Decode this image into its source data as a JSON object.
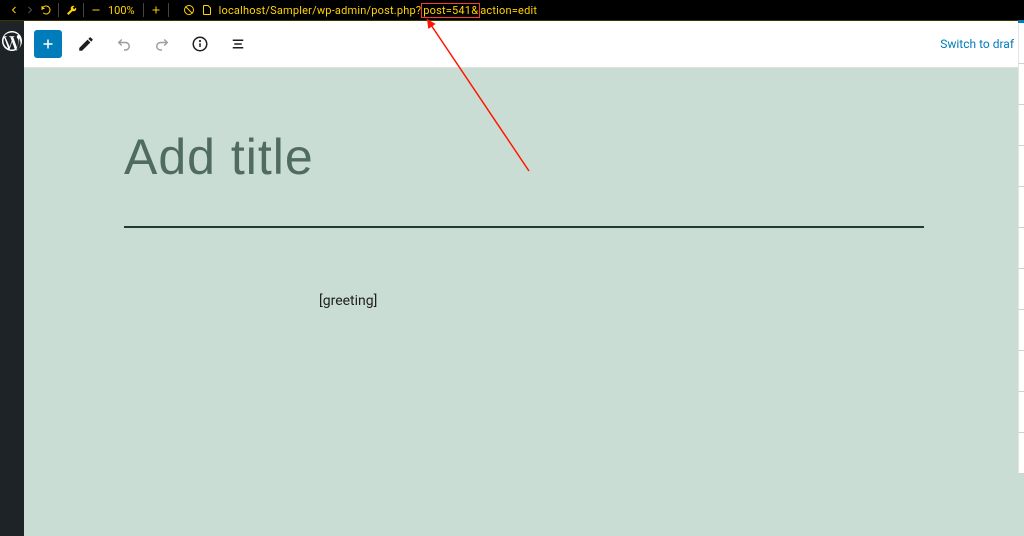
{
  "browser": {
    "zoom": "100%",
    "url_pre": "localhost/Sampler/wp-admin/post.php?",
    "url_highlight": "post=541&",
    "url_post": "action=edit"
  },
  "toolbar": {
    "switch_draft": "Switch to draf"
  },
  "editor": {
    "title_placeholder": "Add title",
    "shortcode": "[greeting]"
  }
}
